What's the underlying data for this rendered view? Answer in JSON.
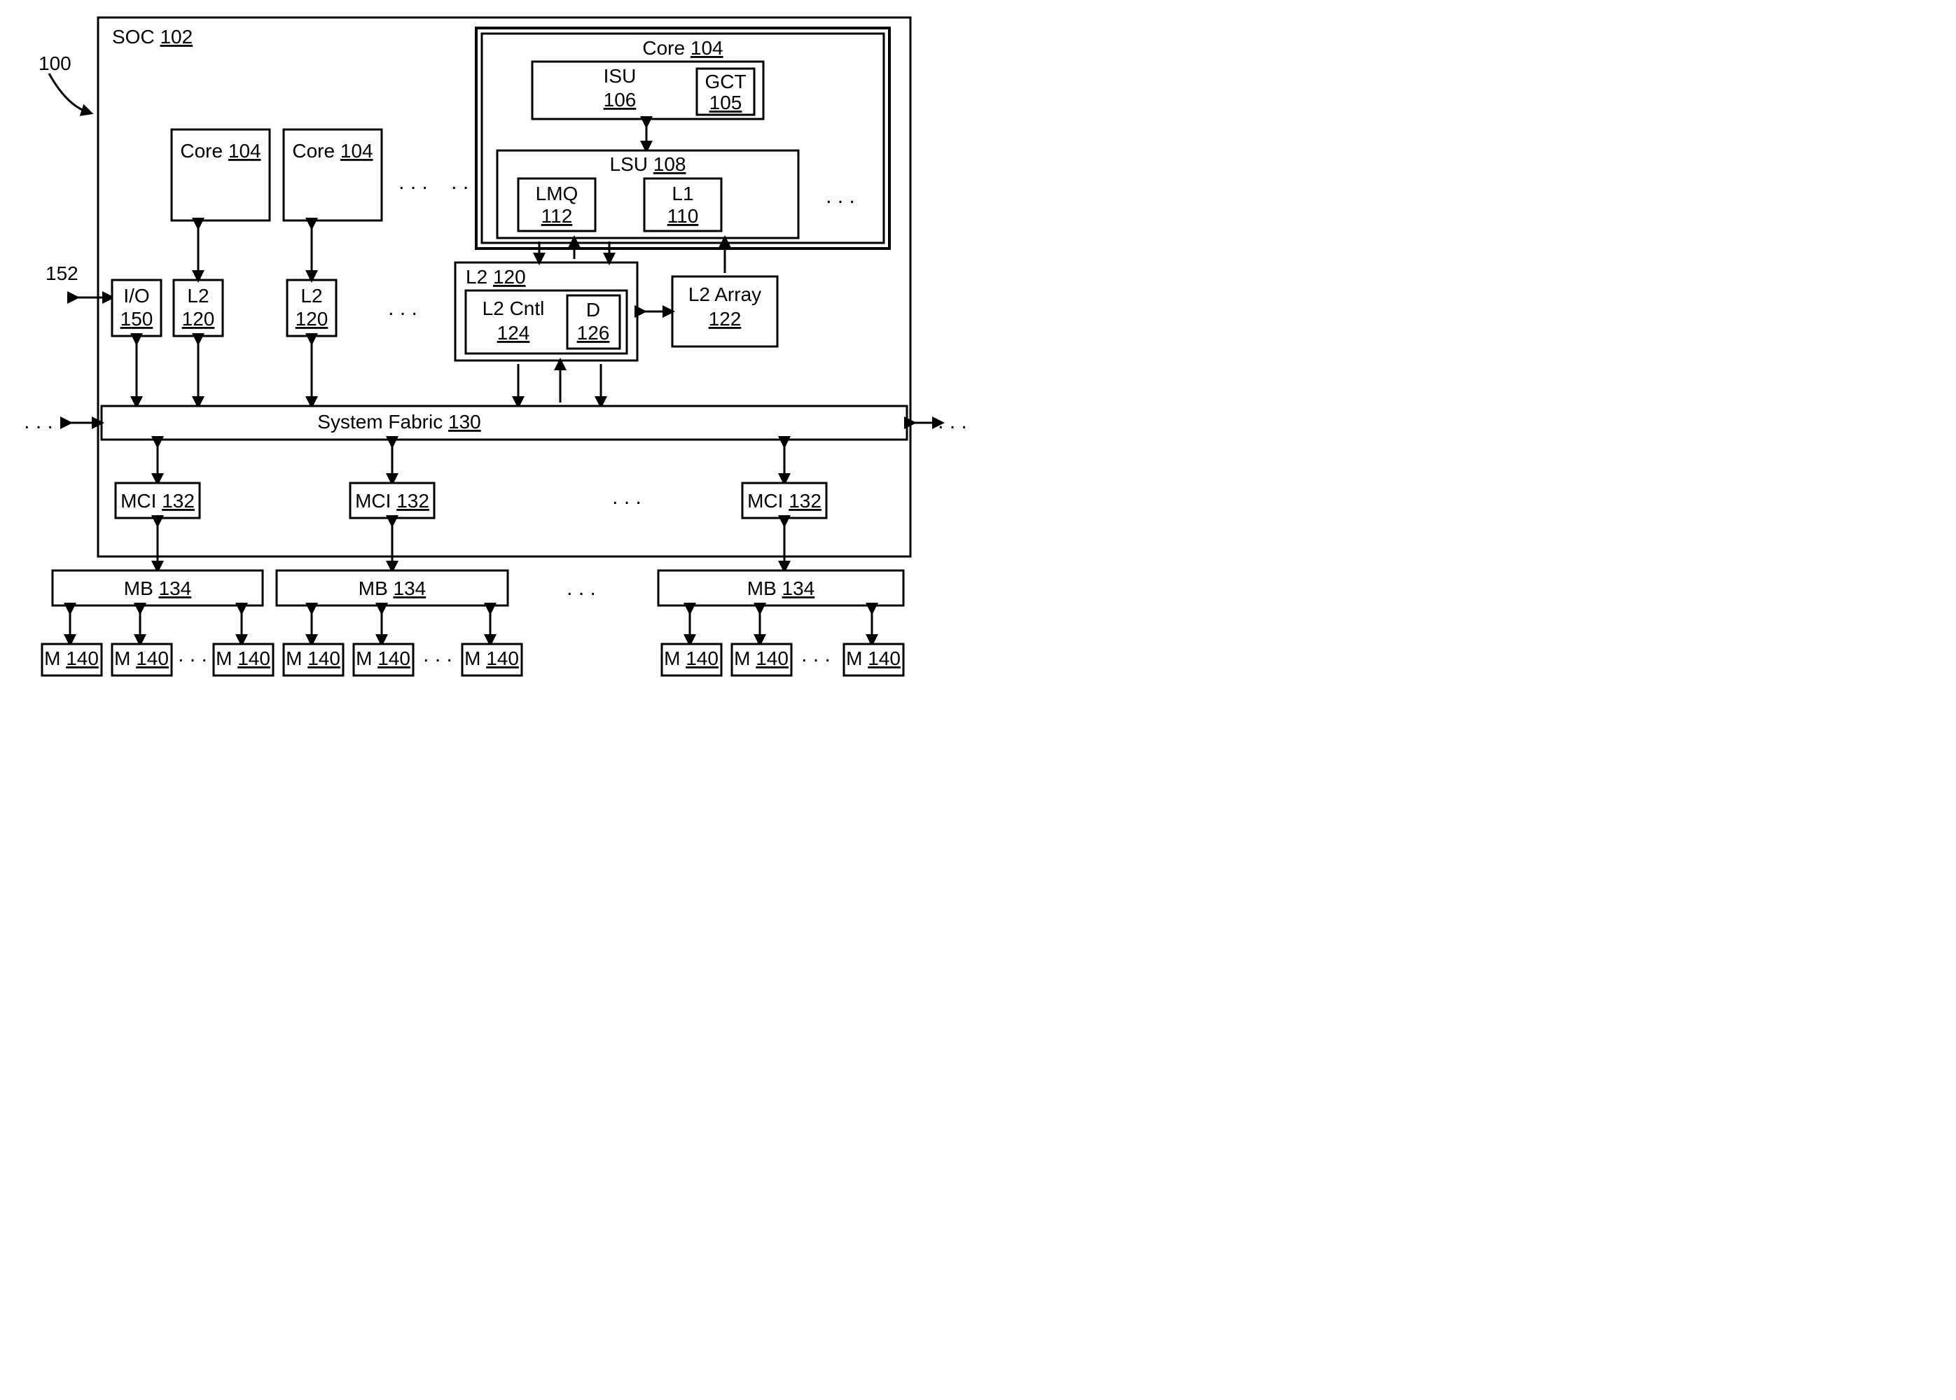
{
  "refLabel100": "100",
  "refLabel152": "152",
  "soc": {
    "label": "SOC",
    "ref": "102"
  },
  "coreSmallA": {
    "label": "Core",
    "ref": "104"
  },
  "coreSmallB": {
    "label": "Core",
    "ref": "104"
  },
  "io": {
    "label": "I/O",
    "ref": "150"
  },
  "l2_a": {
    "label": "L2",
    "ref": "120"
  },
  "l2_b": {
    "label": "L2",
    "ref": "120"
  },
  "coreBig": {
    "label": "Core",
    "ref": "104"
  },
  "isu": {
    "label": "ISU",
    "ref": "106"
  },
  "gct": {
    "label": "GCT",
    "ref": "105"
  },
  "lsu": {
    "label": "LSU",
    "ref": "108"
  },
  "lmq": {
    "label": "LMQ",
    "ref": "112"
  },
  "l1": {
    "label": "L1",
    "ref": "110"
  },
  "l2det": {
    "label": "L2",
    "ref": "120"
  },
  "l2cntl": {
    "label": "L2 Cntl",
    "ref": "124"
  },
  "d": {
    "label": "D",
    "ref": "126"
  },
  "l2array": {
    "label": "L2 Array",
    "ref": "122"
  },
  "fabric": {
    "label": "System Fabric",
    "ref": "130"
  },
  "mci1": {
    "label": "MCI",
    "ref": "132"
  },
  "mci2": {
    "label": "MCI",
    "ref": "132"
  },
  "mci3": {
    "label": "MCI",
    "ref": "132"
  },
  "mb1": {
    "label": "MB",
    "ref": "134"
  },
  "mb2": {
    "label": "MB",
    "ref": "134"
  },
  "mb3": {
    "label": "MB",
    "ref": "134"
  },
  "m": {
    "label": "M",
    "ref": "140"
  },
  "dots": ". . ."
}
